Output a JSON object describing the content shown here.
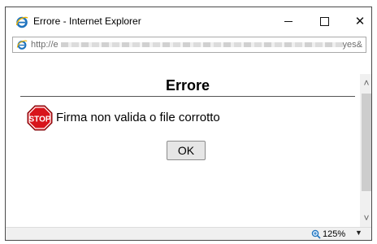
{
  "window": {
    "title": "Errore - Internet Explorer",
    "minimize_glyph": "",
    "close_glyph": "✕"
  },
  "address_bar": {
    "url_prefix": "http://e",
    "url_suffix": "yes&"
  },
  "dialog": {
    "heading": "Errore",
    "message": "Firma non valida o file corrotto",
    "ok_label": "OK",
    "icon_label": "STOP"
  },
  "scrollbar": {
    "up_glyph": "˄",
    "down_glyph": "˅"
  },
  "status_bar": {
    "zoom": "125%",
    "zoom_caret": "▼"
  },
  "colors": {
    "stop_red": "#d8141b",
    "ie_blue": "#1e73be",
    "ie_ring": "#f0b400"
  },
  "icons": [
    "ie-logo-icon",
    "ie-page-icon",
    "stop-sign-icon",
    "zoom-magnifier-icon"
  ]
}
